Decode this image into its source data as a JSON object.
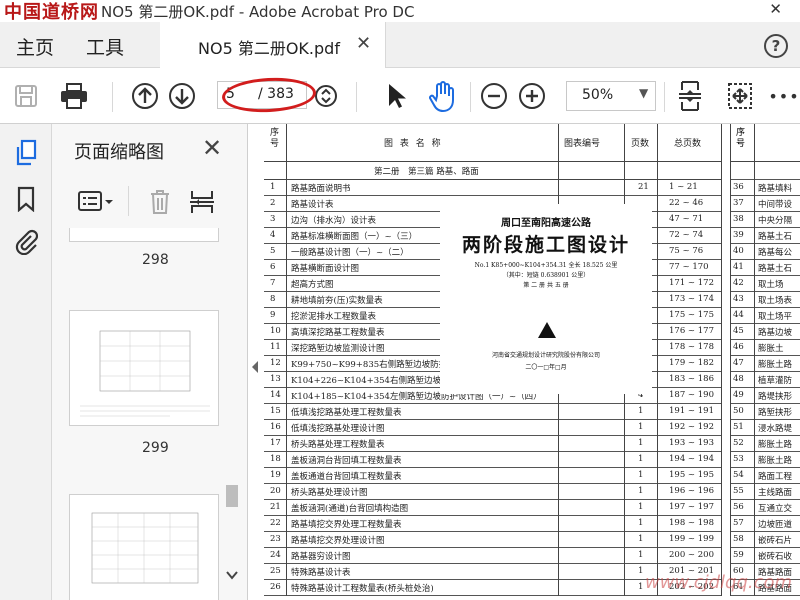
{
  "window": {
    "logo": "中国道桥网",
    "title": "NO5 第二册OK.pdf - Adobe Acrobat Pro DC",
    "close_glyph": "✕"
  },
  "menu": {
    "home": "主页",
    "tools": "工具",
    "tab_label": "NO5 第二册OK.pdf",
    "tab_close": "✕",
    "help": "?"
  },
  "toolbar": {
    "page_current": "5",
    "page_total": "/ 383",
    "zoom": "50%",
    "zoom_caret": "▼",
    "more": "•••"
  },
  "thumbnails": {
    "panel_title": "页面缩略图",
    "close": "✕",
    "page_labels": [
      "298",
      "299"
    ]
  },
  "document": {
    "headers": {
      "seq": "序号",
      "name": "图 表 名 称",
      "code": "图表编号",
      "pages": "页数",
      "total": "总页数",
      "rseq": "序号"
    },
    "section": "第二册　第三篇 路基、路面",
    "rows": [
      {
        "n": "1",
        "name": "路基路面说明书",
        "pg": "21",
        "range": "1 ~ 21"
      },
      {
        "n": "2",
        "name": "路基设计表",
        "pg": "",
        "range": "22 ~ 46"
      },
      {
        "n": "3",
        "name": "边沟（排水沟）设计表",
        "pg": "",
        "range": "47 ~ 71"
      },
      {
        "n": "4",
        "name": "路基标准横断面图（一）~（三）",
        "pg": "",
        "range": "72 ~ 74"
      },
      {
        "n": "5",
        "name": "一般路基设计图（一）~（二）",
        "pg": "",
        "range": "75 ~ 76"
      },
      {
        "n": "6",
        "name": "路基横断面设计图",
        "pg": "",
        "range": "77 ~ 170"
      },
      {
        "n": "7",
        "name": "超高方式图",
        "pg": "",
        "range": "171 ~ 172"
      },
      {
        "n": "8",
        "name": "耕地填前夯(压)实数量表",
        "pg": "",
        "range": "173 ~ 174"
      },
      {
        "n": "9",
        "name": "挖淤泥排水工程数量表",
        "pg": "",
        "range": "175 ~ 175"
      },
      {
        "n": "10",
        "name": "高填深挖路基工程数量表",
        "pg": "",
        "range": "176 ~ 177"
      },
      {
        "n": "11",
        "name": "深挖路堑边坡监测设计图",
        "pg": "",
        "range": "178 ~ 178"
      },
      {
        "n": "12",
        "name": "K99+750~K99+835右侧路堑边坡防护",
        "pg": "",
        "range": "179 ~ 182"
      },
      {
        "n": "13",
        "name": "K104+226~K104+354右侧路堑边坡防护设计图（一）~（四）",
        "pg": "4",
        "range": "183 ~ 186"
      },
      {
        "n": "14",
        "name": "K104+185~K104+354左侧路堑边坡防护设计图（一）~（四）",
        "pg": "4",
        "range": "187 ~ 190"
      },
      {
        "n": "15",
        "name": "低填浅挖路基处理工程数量表",
        "pg": "1",
        "range": "191 ~ 191"
      },
      {
        "n": "16",
        "name": "低填浅挖路基处理设计图",
        "pg": "1",
        "range": "192 ~ 192"
      },
      {
        "n": "17",
        "name": "桥头路基处理工程数量表",
        "pg": "1",
        "range": "193 ~ 193"
      },
      {
        "n": "18",
        "name": "盖板涵洞台背回填工程数量表",
        "pg": "1",
        "range": "194 ~ 194"
      },
      {
        "n": "19",
        "name": "盖板通道台背回填工程数量表",
        "pg": "1",
        "range": "195 ~ 195"
      },
      {
        "n": "20",
        "name": "桥头路基处理设计图",
        "pg": "1",
        "range": "196 ~ 196"
      },
      {
        "n": "21",
        "name": "盖板涵洞(通道)台背回填构造图",
        "pg": "1",
        "range": "197 ~ 197"
      },
      {
        "n": "22",
        "name": "路基填挖交界处理工程数量表",
        "pg": "1",
        "range": "198 ~ 198"
      },
      {
        "n": "23",
        "name": "路基填挖交界处理设计图",
        "pg": "1",
        "range": "199 ~ 199"
      },
      {
        "n": "24",
        "name": "路基器穷设计图",
        "pg": "1",
        "range": "200 ~ 200"
      },
      {
        "n": "25",
        "name": "特殊路基设计表",
        "pg": "1",
        "range": "201 ~ 201"
      },
      {
        "n": "26",
        "name": "特殊路基设计工程数量表(桥头桩处治)",
        "pg": "1",
        "range": "202 ~ 202"
      }
    ],
    "right_rows": [
      {
        "n": "",
        "name": ""
      },
      {
        "n": "36",
        "name": "路基填料"
      },
      {
        "n": "37",
        "name": "中间带设"
      },
      {
        "n": "38",
        "name": "中央分隔"
      },
      {
        "n": "39",
        "name": "路基土石"
      },
      {
        "n": "40",
        "name": "路基每公"
      },
      {
        "n": "41",
        "name": "路基土石"
      },
      {
        "n": "42",
        "name": "取土场"
      },
      {
        "n": "43",
        "name": "取土场表"
      },
      {
        "n": "44",
        "name": "取土场平"
      },
      {
        "n": "45",
        "name": "路基边坡"
      },
      {
        "n": "46",
        "name": "膨胀土"
      },
      {
        "n": "47",
        "name": "膨胀土路"
      },
      {
        "n": "48",
        "name": "植草灌防"
      },
      {
        "n": "49",
        "name": "路堤挟形"
      },
      {
        "n": "50",
        "name": "路堑挟形"
      },
      {
        "n": "51",
        "name": "浸水路堤"
      },
      {
        "n": "52",
        "name": "膨胀土路"
      },
      {
        "n": "53",
        "name": "膨胀土路"
      },
      {
        "n": "54",
        "name": "路面工程"
      },
      {
        "n": "55",
        "name": "主线路面"
      },
      {
        "n": "56",
        "name": "互通立交"
      },
      {
        "n": "57",
        "name": "边坡匝道"
      },
      {
        "n": "58",
        "name": "嵌砖石片"
      },
      {
        "n": "59",
        "name": "嵌砖石收"
      },
      {
        "n": "60",
        "name": "路基路面"
      },
      {
        "n": "61",
        "name": "路基路面"
      }
    ],
    "cover": {
      "subtitle": "周口至南阳高速公路",
      "title": "两阶段施工图设计",
      "line1": "No.1 K85+000~K104+354.31 全长 18.525 公里",
      "line2": "（其中：短链 0.638901 公里）",
      "line3": "第 二 册 共 五 册",
      "org": "河南省交通规划设计研究院股份有限公司",
      "date": "二〇一□年□月"
    }
  },
  "watermark": "www.cjdlqq.com"
}
